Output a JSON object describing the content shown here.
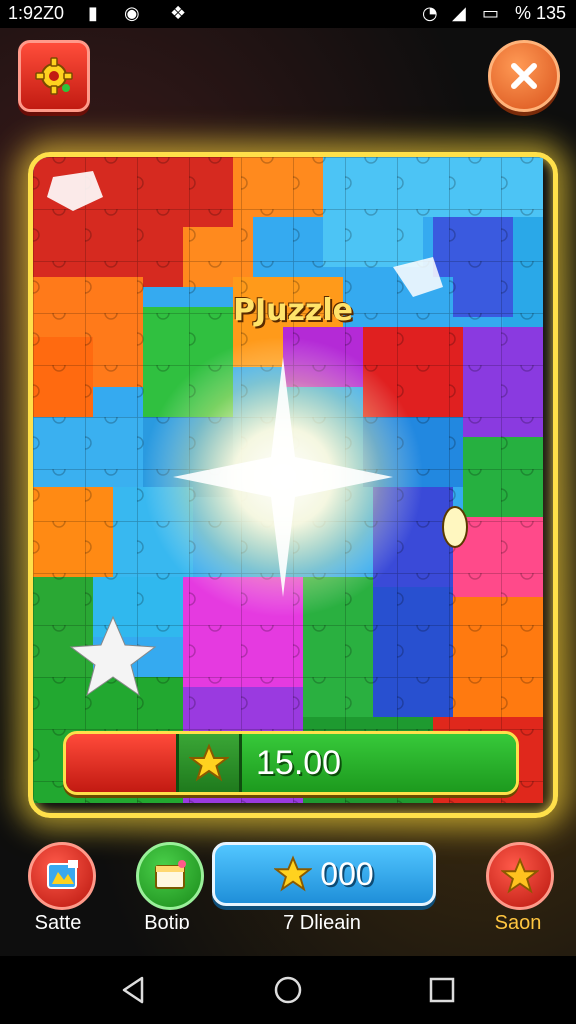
{
  "status_bar": {
    "time": "1:92Z0",
    "battery": "% 135"
  },
  "game": {
    "title": "PJuzzle",
    "progress_value": "15.00",
    "score_value": "000",
    "bottom": {
      "left_label": "Satte",
      "second_label": "Botiɒ",
      "center_label": "7  Dlieain",
      "right_label": "Saon"
    }
  },
  "icons": {
    "settings": "gear-icon",
    "close": "close-icon",
    "star": "star-icon",
    "map": "map-icon",
    "board": "board-icon",
    "back": "back-icon",
    "home": "home-icon",
    "recents": "recents-icon"
  },
  "colors": {
    "frame": "#ffe04a",
    "progress_red": "#e0281c",
    "progress_green": "#2fb52f",
    "score_blue": "#2fa8ee",
    "saon_label": "#ffc640"
  }
}
